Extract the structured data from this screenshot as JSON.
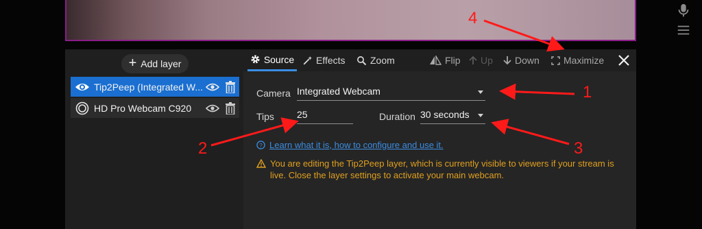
{
  "layers": {
    "add_label": "Add layer",
    "items": [
      {
        "name": "Tip2Peep (Integrated W...",
        "active": true
      },
      {
        "name": "HD Pro Webcam C920",
        "active": false
      }
    ]
  },
  "tabs": [
    {
      "label": "Source",
      "icon": "gear-icon",
      "active": true
    },
    {
      "label": "Effects",
      "icon": "magic-wand-icon",
      "active": false
    },
    {
      "label": "Zoom",
      "icon": "magnify-icon",
      "active": false
    }
  ],
  "toolbar": {
    "flip": "Flip",
    "up": "Up",
    "down": "Down",
    "maximize": "Maximize"
  },
  "form": {
    "camera_label": "Camera",
    "camera_value": "Integrated Webcam",
    "tips_label": "Tips",
    "tips_value": "25",
    "duration_label": "Duration",
    "duration_value": "30 seconds"
  },
  "help_link": "Learn what it is, how to configure and use it.",
  "warning": "You are editing the Tip2Peep layer, which is currently visible to viewers if your stream is live. Close the layer settings to activate your main webcam.",
  "annotations": [
    "1",
    "2",
    "3",
    "4"
  ],
  "colors": {
    "accent": "#1a6fd1",
    "link": "#3b8de2",
    "warning": "#e0a020",
    "annotation": "#ff1a1a"
  }
}
